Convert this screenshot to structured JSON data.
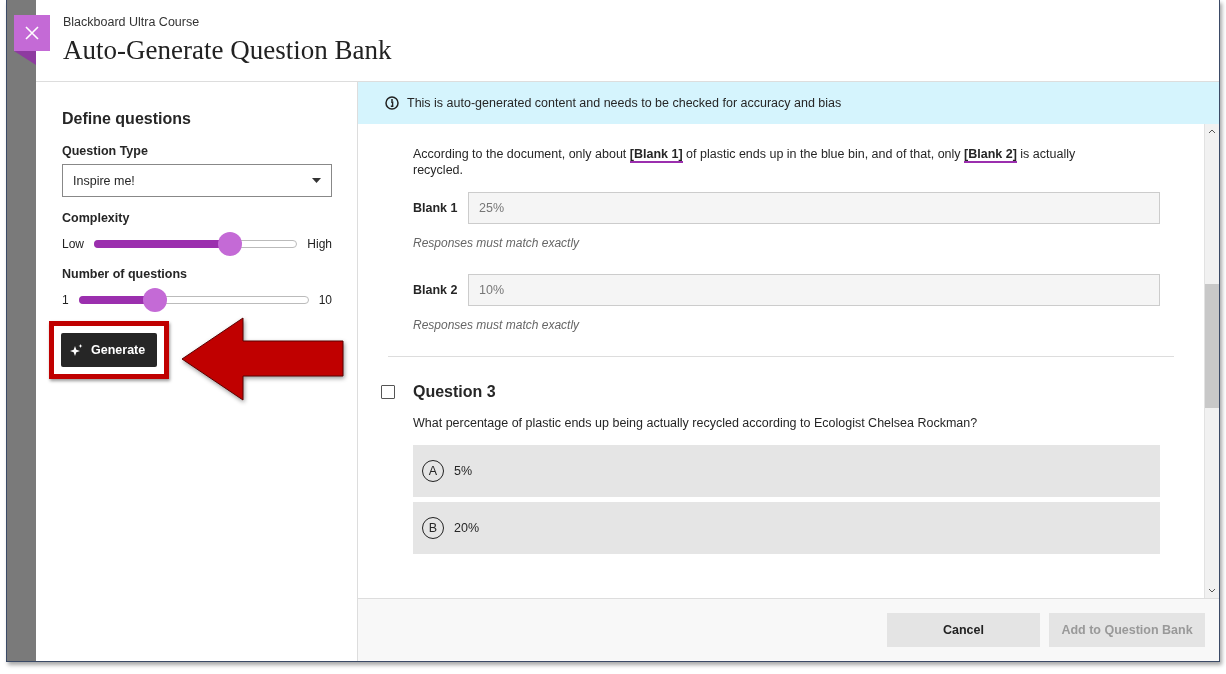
{
  "course": "Blackboard Ultra Course",
  "title": "Auto-Generate Question Bank",
  "sidebar": {
    "heading": "Define questions",
    "question_type": {
      "label": "Question Type",
      "value": "Inspire me!"
    },
    "complexity": {
      "label": "Complexity",
      "min_label": "Low",
      "max_label": "High",
      "level": 0.67
    },
    "number_of_questions": {
      "label": "Number of questions",
      "min_label": "1",
      "max_label": "10",
      "level": 0.33
    },
    "generate_button": "Generate"
  },
  "notice": "This is auto-generated content and needs to be checked for accuracy and bias",
  "questions": [
    {
      "kind": "fill_blank",
      "prompt": "According to the document, only about **[Blank 1]** of plastic ends up in the blue bin, and of that, only **[Blank 2]** is actually recycled.",
      "blanks": [
        {
          "label": "Blank 1",
          "value": "25%",
          "hint": "Responses must match exactly"
        },
        {
          "label": "Blank 2",
          "value": "10%",
          "hint": "Responses must match exactly"
        }
      ]
    },
    {
      "kind": "multiple_choice",
      "title": "Question 3",
      "checked": false,
      "prompt": "What percentage of plastic ends up being actually recycled according to Ecologist Chelsea Rockman?",
      "options": [
        {
          "letter": "A",
          "text": "5%"
        },
        {
          "letter": "B",
          "text": "20%"
        }
      ]
    }
  ],
  "footer": {
    "buttons": [
      {
        "label": "Cancel",
        "disabled": false
      },
      {
        "label": "Add to Question Bank",
        "disabled": true
      }
    ]
  }
}
